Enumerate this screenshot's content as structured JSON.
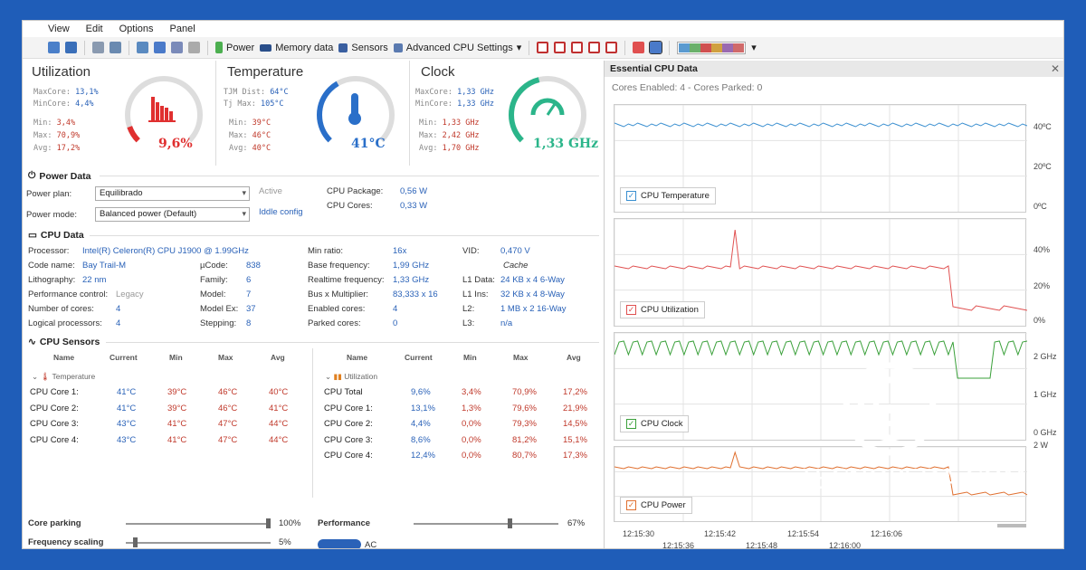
{
  "menu": {
    "items": [
      "View",
      "Edit",
      "Options",
      "Panel"
    ]
  },
  "toolbar": {
    "power": "Power",
    "memory": "Memory data",
    "sensors": "Sensors",
    "advanced": "Advanced CPU Settings"
  },
  "utilization": {
    "title": "Utilization",
    "maxcore_label": "MaxCore:",
    "maxcore": "13,1%",
    "mincore_label": "MinCore:",
    "mincore": "4,4%",
    "min_label": "Min:",
    "min": "3,4%",
    "max_label": "Max:",
    "max": "70,9%",
    "avg_label": "Avg:",
    "avg": "17,2%",
    "value": "9,6%",
    "fraction": 0.096
  },
  "temperature": {
    "title": "Temperature",
    "tjm_label": "TJM Dist:",
    "tjm": "64°C",
    "tjmax_label": "Tj Max:",
    "tjmax": "105°C",
    "min_label": "Min:",
    "min": "39°C",
    "max_label": "Max:",
    "max": "46°C",
    "avg_label": "Avg:",
    "avg": "40°C",
    "value": "41°C",
    "fraction": 0.39
  },
  "clock": {
    "title": "Clock",
    "maxcore_label": "MaxCore:",
    "maxcore": "1,33 GHz",
    "mincore_label": "MinCore:",
    "mincore": "1,33 GHz",
    "min_label": "Min:",
    "min": "1,33 GHz",
    "max_label": "Max:",
    "max": "2,42 GHz",
    "avg_label": "Avg:",
    "avg": "1,70 GHz",
    "value": "1,33 GHz",
    "fraction": 0.45
  },
  "power_data": {
    "header": "Power Data",
    "plan_label": "Power plan:",
    "plan": "Equilibrado",
    "plan_state": "Active",
    "mode_label": "Power mode:",
    "mode": "Balanced power (Default)",
    "mode_link": "Iddle config",
    "pkg_label": "CPU Package:",
    "pkg": "0,56 W",
    "cores_label": "CPU Cores:",
    "cores": "0,33 W"
  },
  "cpu_data": {
    "header": "CPU Data",
    "processor_label": "Processor:",
    "processor": "Intel(R) Celeron(R) CPU  J1900  @ 1.99GHz",
    "codename_label": "Code name:",
    "codename": "Bay Trail-M",
    "litho_label": "Lithography:",
    "litho": "22 nm",
    "perf_label": "Performance control:",
    "perf": "Legacy",
    "ncores_label": "Number of cores:",
    "ncores": "4",
    "lproc_label": "Logical processors:",
    "lproc": "4",
    "ucode_label": "µCode:",
    "ucode": "838",
    "family_label": "Family:",
    "family": "6",
    "model_label": "Model:",
    "model": "7",
    "modelex_label": "Model Ex:",
    "modelex": "37",
    "stepping_label": "Stepping:",
    "stepping": "8",
    "minratio_label": "Min ratio:",
    "minratio": "16x",
    "basefreq_label": "Base frequency:",
    "basefreq": "1,99 GHz",
    "rtfreq_label": "Realtime frequency:",
    "rtfreq": "1,33 GHz",
    "bus_label": "Bus x Multiplier:",
    "bus": "83,333 x 16",
    "enabled_label": "Enabled cores:",
    "enabled": "4",
    "parked_label": "Parked cores:",
    "parked": "0",
    "vid_label": "VID:",
    "vid": "0,470 V",
    "cache_label": "Cache",
    "l1d_label": "L1 Data:",
    "l1d": "24 KB x 4  6-Way",
    "l1i_label": "L1 Ins:",
    "l1i": "32 KB x 4  8-Way",
    "l2_label": "L2:",
    "l2": "1 MB x 2  16-Way",
    "l3_label": "L3:",
    "l3": "n/a"
  },
  "sensors": {
    "header": "CPU Sensors",
    "cols": [
      "Name",
      "Current",
      "Min",
      "Max",
      "Avg"
    ],
    "temp_group": "Temperature",
    "util_group": "Utilization",
    "temp_rows": [
      [
        "CPU Core 1:",
        "41°C",
        "39°C",
        "46°C",
        "40°C"
      ],
      [
        "CPU Core 2:",
        "41°C",
        "39°C",
        "46°C",
        "41°C"
      ],
      [
        "CPU Core 3:",
        "43°C",
        "41°C",
        "47°C",
        "44°C"
      ],
      [
        "CPU Core 4:",
        "43°C",
        "41°C",
        "47°C",
        "44°C"
      ]
    ],
    "util_rows": [
      [
        "CPU Total",
        "9,6%",
        "3,4%",
        "70,9%",
        "17,2%"
      ],
      [
        "CPU Core 1:",
        "13,1%",
        "1,3%",
        "79,6%",
        "21,9%"
      ],
      [
        "CPU Core 2:",
        "4,4%",
        "0,0%",
        "79,3%",
        "14,5%"
      ],
      [
        "CPU Core 3:",
        "8,6%",
        "0,0%",
        "81,2%",
        "15,1%"
      ],
      [
        "CPU Core 4:",
        "12,4%",
        "0,0%",
        "80,7%",
        "17,3%"
      ]
    ]
  },
  "bottom": {
    "parking_label": "Core parking",
    "parking": "100%",
    "parking_fraction": 1.0,
    "freq_label": "Frequency scaling",
    "freq": "5%",
    "freq_fraction": 0.05,
    "perf_label": "Performance",
    "perf": "67%",
    "perf_fraction": 0.67,
    "ac_label": "AC"
  },
  "essential": {
    "title": "Essential CPU Data",
    "cores_status": "Cores Enabled: 4 - Cores Parked: 0",
    "temp_label": "CPU Temperature",
    "temp_ticks": [
      "40ºC",
      "20ºC",
      "0ºC"
    ],
    "util_label": "CPU Utilization",
    "util_ticks": [
      "40%",
      "20%",
      "0%"
    ],
    "clock_label": "CPU Clock",
    "clock_ticks": [
      "2 GHz",
      "1 GHz",
      "0 GHz"
    ],
    "power_label": "CPU Power",
    "power_ticks": [
      "2 W"
    ],
    "time_top": [
      "12:15:30",
      "12:15:42",
      "12:15:54",
      "12:16:06"
    ],
    "time_bottom": [
      "12:15:36",
      "12:15:48",
      "12:16:00"
    ]
  },
  "brand": {
    "text": "TECNOPEDA.COM",
    "accent": "#1f5db8"
  },
  "colors": {
    "util": "#e03030",
    "temp": "#2a6fc9",
    "clock": "#2bb58a",
    "line_temp": "#3a8fd0",
    "line_util": "#e05050",
    "line_clock": "#3aa03a",
    "line_power": "#e07030"
  }
}
